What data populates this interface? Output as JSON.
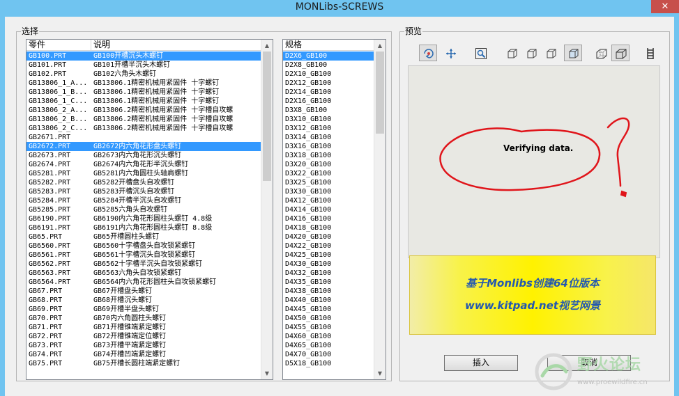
{
  "window": {
    "title": "MONLibs-SCREWS",
    "close_glyph": "✕"
  },
  "select_group": {
    "label": "选择"
  },
  "parts_list": {
    "col_part": "零件",
    "col_desc": "说明",
    "rows": [
      {
        "part": "GB100.PRT",
        "desc": "GB100开槽沉头木螺钉",
        "selected": true
      },
      {
        "part": "GB101.PRT",
        "desc": "GB101开槽半沉头木螺钉"
      },
      {
        "part": "GB102.PRT",
        "desc": "GB102六角头木螺钉"
      },
      {
        "part": "GB13806_1_A...",
        "desc": "GB13806.1精密机械用紧固件    十字螺钉"
      },
      {
        "part": "GB13806_1_B...",
        "desc": "GB13806.1精密机械用紧固件    十字螺钉"
      },
      {
        "part": "GB13806_1_C...",
        "desc": "GB13806.1精密机械用紧固件    十字螺钉"
      },
      {
        "part": "GB13806_2_A...",
        "desc": "GB13806.2精密机械用紧固件   十字槽自攻螺"
      },
      {
        "part": "GB13806_2_B...",
        "desc": "GB13806.2精密机械用紧固件   十字槽自攻螺"
      },
      {
        "part": "GB13806_2_C...",
        "desc": "GB13806.2精密机械用紧固件   十字槽自攻螺"
      },
      {
        "part": "GB2671.PRT",
        "desc": ""
      },
      {
        "part": "GB2672.PRT",
        "desc": "GB2672内六角花形盘头螺钉",
        "selected": true
      },
      {
        "part": "GB2673.PRT",
        "desc": "GB2673内六角花形沉头螺钉"
      },
      {
        "part": "GB2674.PRT",
        "desc": "GB2674内六角花形半沉头螺钉"
      },
      {
        "part": "GB5281.PRT",
        "desc": "GB5281内六角圆柱头轴肩螺钉"
      },
      {
        "part": "GB5282.PRT",
        "desc": "GB5282开槽盘头自攻螺钉"
      },
      {
        "part": "GB5283.PRT",
        "desc": "GB5283开槽沉头自攻螺钉"
      },
      {
        "part": "GB5284.PRT",
        "desc": "GB5284开槽半沉头自攻螺钉"
      },
      {
        "part": "GB5285.PRT",
        "desc": "GB5285六角头自攻螺钉"
      },
      {
        "part": "GB6190.PRT",
        "desc": "GB6190内六角花形圆柱头螺钉  4.8级"
      },
      {
        "part": "GB6191.PRT",
        "desc": "GB6191内六角花形圆柱头螺钉  8.8级"
      },
      {
        "part": "GB65.PRT",
        "desc": "GB65开槽圆柱头螺钉"
      },
      {
        "part": "GB6560.PRT",
        "desc": "GB6560十字槽盘头自攻锁紧螺钉"
      },
      {
        "part": "GB6561.PRT",
        "desc": "GB6561十字槽沉头自攻锁紧螺钉"
      },
      {
        "part": "GB6562.PRT",
        "desc": "GB6562十字槽半沉头自攻锁紧螺钉"
      },
      {
        "part": "GB6563.PRT",
        "desc": "GB6563六角头自攻锁紧螺钉"
      },
      {
        "part": "GB6564.PRT",
        "desc": "GB6564内六角花形圆柱头自攻锁紧螺钉"
      },
      {
        "part": "GB67.PRT",
        "desc": "GB67开槽盘头螺钉"
      },
      {
        "part": "GB68.PRT",
        "desc": "GB68开槽沉头螺钉"
      },
      {
        "part": "GB69.PRT",
        "desc": "GB69开槽半盘头螺钉"
      },
      {
        "part": "GB70.PRT",
        "desc": "GB70内六角圆柱头螺钉"
      },
      {
        "part": "GB71.PRT",
        "desc": "GB71开槽锥端紧定螺钉"
      },
      {
        "part": "GB72.PRT",
        "desc": "GB72开槽锥端定位螺钉"
      },
      {
        "part": "GB73.PRT",
        "desc": "GB73开槽平端紧定螺钉"
      },
      {
        "part": "GB74.PRT",
        "desc": "GB74开槽凹端紧定螺钉"
      },
      {
        "part": "GB75.PRT",
        "desc": "GB75开槽长圆柱端紧定螺钉"
      }
    ]
  },
  "spec_list": {
    "col_spec": "规格",
    "rows": [
      {
        "spec": "D2X6_GB100",
        "selected": true
      },
      {
        "spec": "D2X8_GB100"
      },
      {
        "spec": "D2X10_GB100"
      },
      {
        "spec": "D2X12_GB100"
      },
      {
        "spec": "D2X14_GB100"
      },
      {
        "spec": "D2X16_GB100"
      },
      {
        "spec": "D3X8_GB100"
      },
      {
        "spec": "D3X10_GB100"
      },
      {
        "spec": "D3X12_GB100"
      },
      {
        "spec": "D3X14_GB100"
      },
      {
        "spec": "D3X16_GB100"
      },
      {
        "spec": "D3X18_GB100"
      },
      {
        "spec": "D3X20_GB100"
      },
      {
        "spec": "D3X22_GB100"
      },
      {
        "spec": "D3X25_GB100"
      },
      {
        "spec": "D3X30_GB100"
      },
      {
        "spec": "D4X12_GB100"
      },
      {
        "spec": "D4X14_GB100"
      },
      {
        "spec": "D4X16_GB100"
      },
      {
        "spec": "D4X18_GB100"
      },
      {
        "spec": "D4X20_GB100"
      },
      {
        "spec": "D4X22_GB100"
      },
      {
        "spec": "D4X25_GB100"
      },
      {
        "spec": "D4X30_GB100"
      },
      {
        "spec": "D4X32_GB100"
      },
      {
        "spec": "D4X35_GB100"
      },
      {
        "spec": "D4X38_GB100"
      },
      {
        "spec": "D4X40_GB100"
      },
      {
        "spec": "D4X45_GB100"
      },
      {
        "spec": "D4X50_GB100"
      },
      {
        "spec": "D4X55_GB100"
      },
      {
        "spec": "D4X60_GB100"
      },
      {
        "spec": "D4X65_GB100"
      },
      {
        "spec": "D4X70_GB100"
      },
      {
        "spec": "D5X18_GB100"
      }
    ]
  },
  "preview_group": {
    "label": "预览"
  },
  "toolbar": {
    "icons": [
      "rotate-view-icon",
      "pan-view-icon",
      "zoom-fit-icon",
      "view-front-icon",
      "view-top-icon",
      "view-side-icon",
      "view-iso-icon",
      "wireframe-icon",
      "shaded-icon",
      "section-icon"
    ]
  },
  "preview": {
    "status_text": "Verifying data."
  },
  "banner": {
    "line1": "基于Monlibs创建64位版本",
    "line2": "www.kitpad.net视艺网景"
  },
  "buttons": {
    "insert_label": "插入",
    "cancel_label": "取消"
  },
  "watermark": {
    "text": "野火论坛",
    "url": "www.proewildfire.cn"
  },
  "colors": {
    "selection": "#3399ff",
    "title_bar": "#70c4f0",
    "close": "#c7504b",
    "banner_text": "#2358b0",
    "scribble": "#e0151b"
  }
}
